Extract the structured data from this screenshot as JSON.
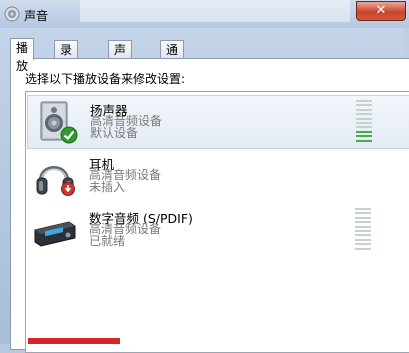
{
  "window": {
    "title": "声音",
    "close_glyph": "✕"
  },
  "tabs": [
    {
      "label": "播放",
      "active": true
    },
    {
      "label": "录制",
      "active": false
    },
    {
      "label": "声音",
      "active": false
    },
    {
      "label": "通信",
      "active": false
    }
  ],
  "panel": {
    "instruction": "选择以下播放设备来修改设置:"
  },
  "devices": [
    {
      "name": "扬声器",
      "line1": "高清音频设备",
      "line2": "默认设备",
      "icon": "speaker-icon",
      "status_icon": "check-icon",
      "selected": true,
      "level_fraction": 0.3
    },
    {
      "name": "耳机",
      "line1": "高清音频设备",
      "line2": "未插入",
      "icon": "headphones-icon",
      "status_icon": "unplugged-icon",
      "selected": false
    },
    {
      "name": "数字音频 (S/PDIF)",
      "line1": "高清音频设备",
      "line2": "已就绪",
      "icon": "digital-audio-icon",
      "selected": false,
      "level_fraction": 0
    }
  ],
  "colors": {
    "meter_on": "#4aa84a",
    "meter_off": "#c6d1cf",
    "check": "#2e9a2e",
    "unplugged": "#c8372d",
    "close": "#c8452d"
  }
}
